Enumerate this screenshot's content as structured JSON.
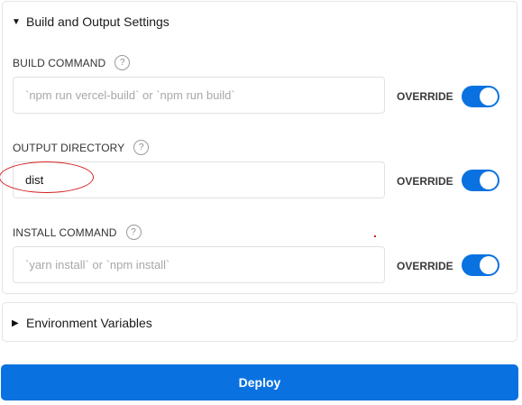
{
  "build_settings": {
    "header": "Build and Output Settings",
    "expanded_icon": "caret-down-icon",
    "fields": [
      {
        "label": "BUILD COMMAND",
        "value": "",
        "placeholder": "`npm run vercel-build` or `npm run build`",
        "override_label": "OVERRIDE",
        "override_on": true
      },
      {
        "label": "OUTPUT DIRECTORY",
        "value": "dist",
        "placeholder": "",
        "override_label": "OVERRIDE",
        "override_on": true
      },
      {
        "label": "INSTALL COMMAND",
        "value": "",
        "placeholder": "`yarn install` or `npm install`",
        "override_label": "OVERRIDE",
        "override_on": true
      }
    ],
    "help_glyph": "?"
  },
  "environment": {
    "header": "Environment Variables",
    "collapsed_icon": "caret-right-icon"
  },
  "deploy": {
    "label": "Deploy"
  },
  "colors": {
    "accent": "#0a72e0",
    "annotation": "#d42020"
  }
}
